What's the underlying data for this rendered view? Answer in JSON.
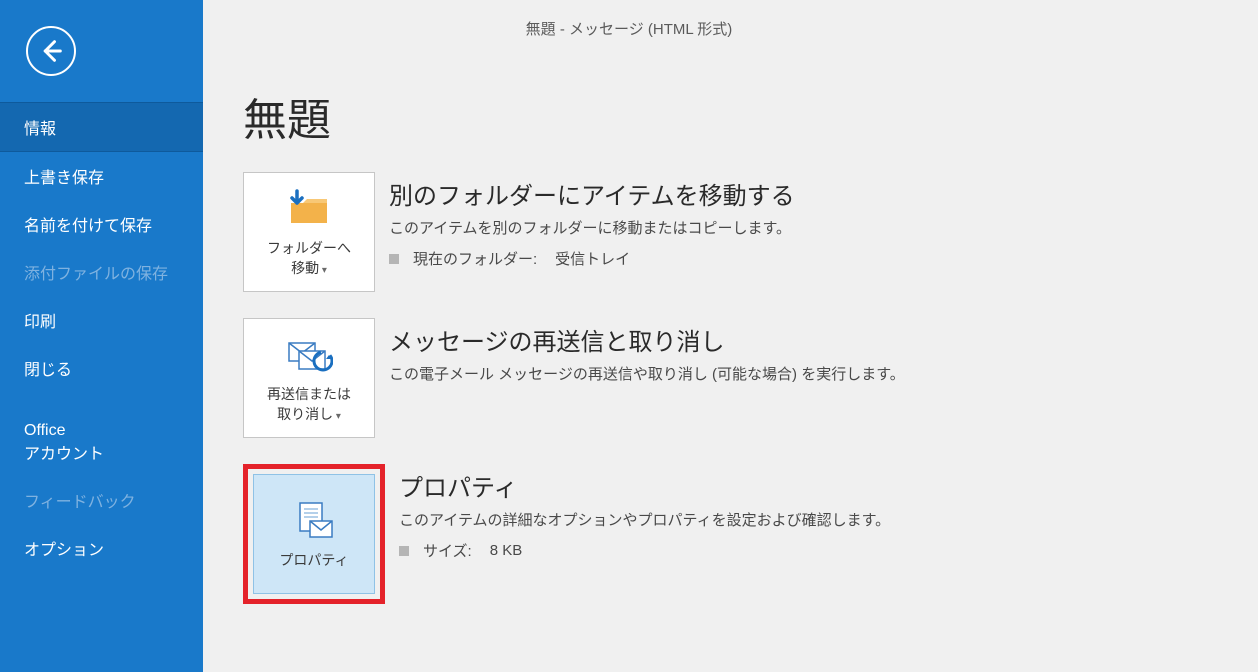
{
  "titlebar": "無題  -  メッセージ (HTML 形式)",
  "sidebar": {
    "items": [
      {
        "label": "情報",
        "selected": true,
        "disabled": false
      },
      {
        "label": "上書き保存",
        "selected": false,
        "disabled": false
      },
      {
        "label": "名前を付けて保存",
        "selected": false,
        "disabled": false
      },
      {
        "label": "添付ファイルの保存",
        "selected": false,
        "disabled": true
      },
      {
        "label": "印刷",
        "selected": false,
        "disabled": false
      },
      {
        "label": "閉じる",
        "selected": false,
        "disabled": false
      }
    ],
    "items2": [
      {
        "label": "Office\nアカウント",
        "selected": false,
        "disabled": false
      },
      {
        "label": "フィードバック",
        "selected": false,
        "disabled": true
      },
      {
        "label": "オプション",
        "selected": false,
        "disabled": false
      }
    ]
  },
  "page_title": "無題",
  "sections": {
    "move": {
      "tile_line1": "フォルダーへ",
      "tile_line2": "移動",
      "title": "別のフォルダーにアイテムを移動する",
      "desc": "このアイテムを別のフォルダーに移動またはコピーします。",
      "kv_label": "現在のフォルダー:",
      "kv_value": "受信トレイ"
    },
    "resend": {
      "tile_line1": "再送信または",
      "tile_line2": "取り消し",
      "title": "メッセージの再送信と取り消し",
      "desc": "この電子メール メッセージの再送信や取り消し (可能な場合) を実行します。"
    },
    "props": {
      "tile_label": "プロパティ",
      "title": "プロパティ",
      "desc": "このアイテムの詳細なオプションやプロパティを設定および確認します。",
      "kv_label": "サイズ:",
      "kv_value": "8 KB"
    }
  }
}
